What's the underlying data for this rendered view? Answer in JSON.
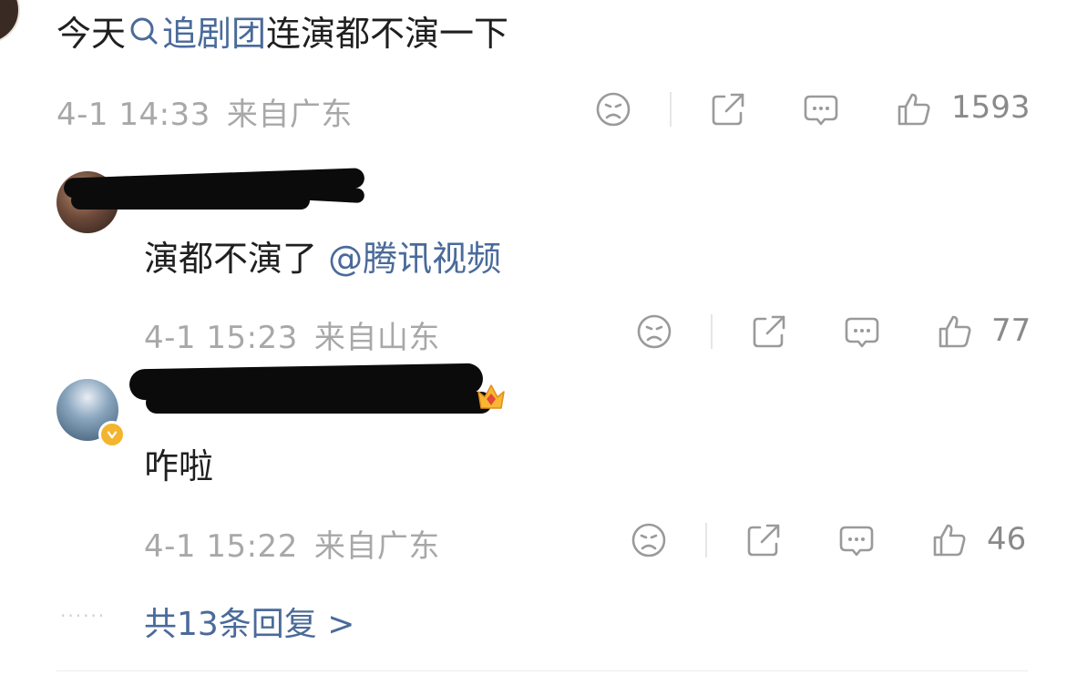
{
  "post": {
    "text_before": "今天",
    "topic_link": "追剧团",
    "text_after": "连演都不演一下",
    "time": "4-1 14:33",
    "location": "来自广东",
    "like_count": "1593"
  },
  "replies": [
    {
      "text": "演都不演了",
      "mention": "@腾讯视频",
      "time": "4-1 15:23",
      "location": "来自山东",
      "like_count": "77"
    },
    {
      "text": "咋啦",
      "time": "4-1 15:22",
      "location": "来自广东",
      "like_count": "46"
    }
  ],
  "more_replies": {
    "dots": "······",
    "label": "共13条回复 >"
  },
  "colors": {
    "link": "#4a6a9a",
    "meta": "#a8a8a8",
    "icon": "#9a9a9a",
    "verify": "#f3b52f"
  },
  "icons": [
    "sad-face-icon",
    "share-icon",
    "comment-icon",
    "thumbs-up-icon",
    "search-icon",
    "crown-icon",
    "verified-badge-icon"
  ]
}
